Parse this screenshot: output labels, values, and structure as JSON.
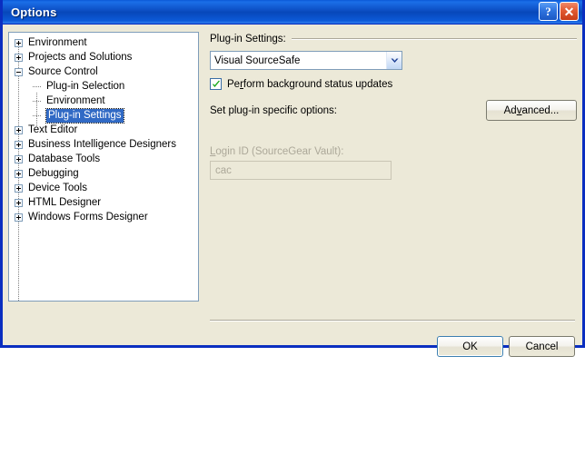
{
  "window": {
    "title": "Options",
    "help_button": "?",
    "close_button": "✕"
  },
  "tree": {
    "nodes": [
      {
        "label": "Environment",
        "level": 0,
        "state": "collapsed",
        "selected": false
      },
      {
        "label": "Projects and Solutions",
        "level": 0,
        "state": "collapsed",
        "selected": false
      },
      {
        "label": "Source Control",
        "level": 0,
        "state": "expanded",
        "selected": false
      },
      {
        "label": "Plug-in Selection",
        "level": 1,
        "state": "leaf",
        "selected": false
      },
      {
        "label": "Environment",
        "level": 1,
        "state": "leaf",
        "selected": false
      },
      {
        "label": "Plug-in Settings",
        "level": 1,
        "state": "leaf",
        "selected": true
      },
      {
        "label": "Text Editor",
        "level": 0,
        "state": "collapsed",
        "selected": false
      },
      {
        "label": "Business Intelligence Designers",
        "level": 0,
        "state": "collapsed",
        "selected": false
      },
      {
        "label": "Database Tools",
        "level": 0,
        "state": "collapsed",
        "selected": false
      },
      {
        "label": "Debugging",
        "level": 0,
        "state": "collapsed",
        "selected": false
      },
      {
        "label": "Device Tools",
        "level": 0,
        "state": "collapsed",
        "selected": false
      },
      {
        "label": "HTML Designer",
        "level": 0,
        "state": "collapsed",
        "selected": false
      },
      {
        "label": "Windows Forms Designer",
        "level": 0,
        "state": "collapsed",
        "selected": false
      }
    ]
  },
  "panel": {
    "group_label_pre": "Plu",
    "group_label_accel": "g",
    "group_label_post": "-in Settings:",
    "plugin_combo": {
      "value": "Visual SourceSafe",
      "options": [
        "Visual SourceSafe"
      ]
    },
    "checkbox": {
      "label_pre": "Pe",
      "label_accel": "r",
      "label_post": "form background status updates",
      "checked": true
    },
    "set_options_label": "Set plug-in specific options:",
    "advanced_button": {
      "label_pre": "Ad",
      "label_accel": "v",
      "label_post": "anced..."
    },
    "login": {
      "label_accel": "L",
      "label_post": "ogin ID (SourceGear Vault):",
      "value": "cac",
      "enabled": false
    }
  },
  "footer": {
    "ok_label": "OK",
    "cancel_label": "Cancel"
  },
  "colors": {
    "titlebar_blue": "#0e52c8",
    "dialog_border": "#0a2ec0",
    "face": "#ece9d8",
    "selection": "#316ac5",
    "disabled_text": "#aca899",
    "check_green": "#17a817"
  }
}
